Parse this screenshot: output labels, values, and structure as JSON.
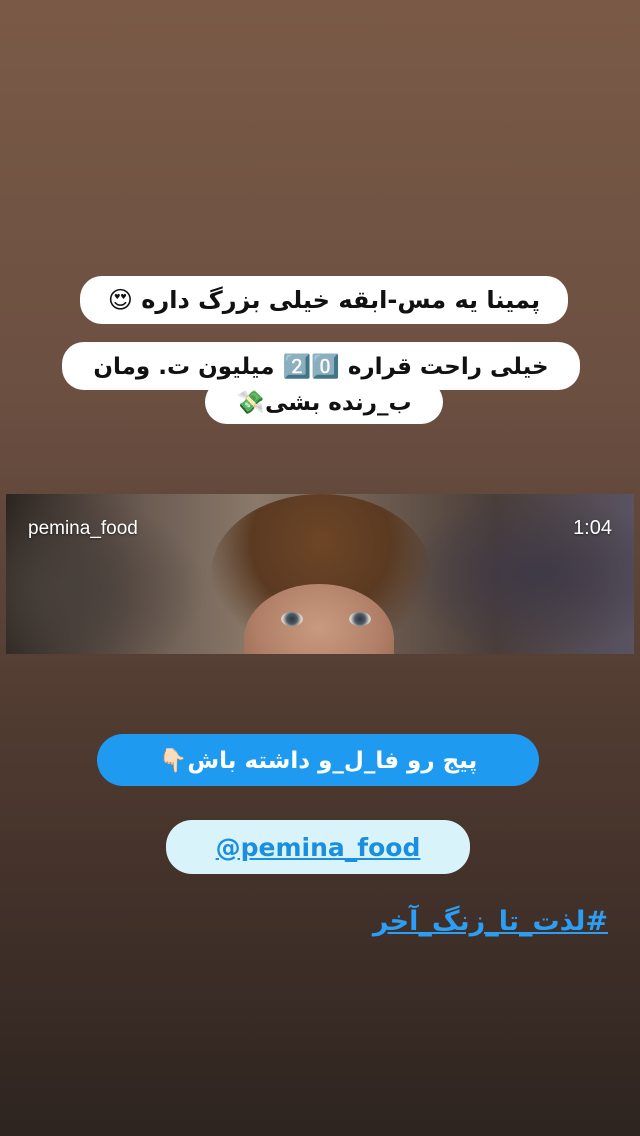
{
  "story": {
    "caption_line1": "پمینا یه مس-ابقه خیلی بزرگ داره 😍",
    "caption_line2": "خیلی راحت قراره 2️⃣0️⃣ میلیون ت. ومان",
    "caption_line3": "ب_رنده بشی💸",
    "video": {
      "username": "pemina_food",
      "duration": "1:04"
    },
    "follow_text": "پیج رو فا_ل_و داشته باش👇🏻",
    "mention": "@pemina_food",
    "hashtag": "#لذت_تا_زنگ_آخر"
  }
}
